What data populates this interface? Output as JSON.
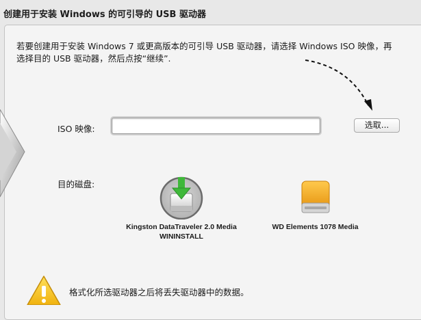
{
  "section": {
    "title": "创建用于安装 Windows 的可引导的 USB 驱动器"
  },
  "intro": {
    "text": "若要创建用于安装 Windows 7 或更高版本的可引导 USB 驱动器，请选择 Windows ISO 映像，再选择目的 USB 驱动器，然后点按“继续”."
  },
  "iso": {
    "label": "ISO 映像:",
    "value": "",
    "choose_label": "选取..."
  },
  "destination": {
    "label": "目的磁盘:",
    "disks": [
      {
        "name": "Kingston DataTraveler 2.0 Media",
        "volume": "WININSTALL",
        "selected": true,
        "icon": "usb-drive-install-icon"
      },
      {
        "name": "WD Elements 1078 Media",
        "volume": "",
        "selected": false,
        "icon": "external-hard-drive-icon"
      }
    ]
  },
  "warning": {
    "text": "格式化所选驱动器之后将丢失驱动器中的数据。",
    "icon": "warning-triangle-icon"
  },
  "colors": {
    "drive_orange": "#f2a91e",
    "arrow_green": "#3fb83a",
    "warning_yellow": "#f5c21b"
  }
}
